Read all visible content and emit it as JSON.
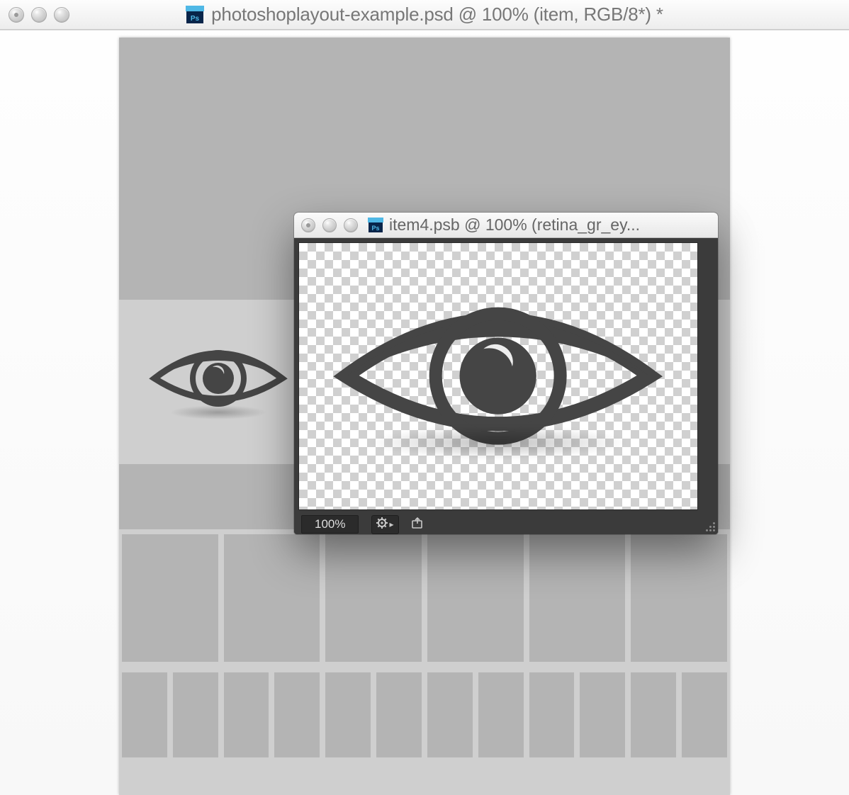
{
  "main_window": {
    "title": "photoshoplayout-example.psd @ 100% (item, RGB/8*) *",
    "file_icon": "photoshop-file-icon"
  },
  "float_window": {
    "title": "item4.psb @ 100% (retina_gr_ey...",
    "file_icon": "photoshop-file-icon",
    "zoom_label": "100%"
  },
  "colors": {
    "eye_icon": "#454545"
  }
}
